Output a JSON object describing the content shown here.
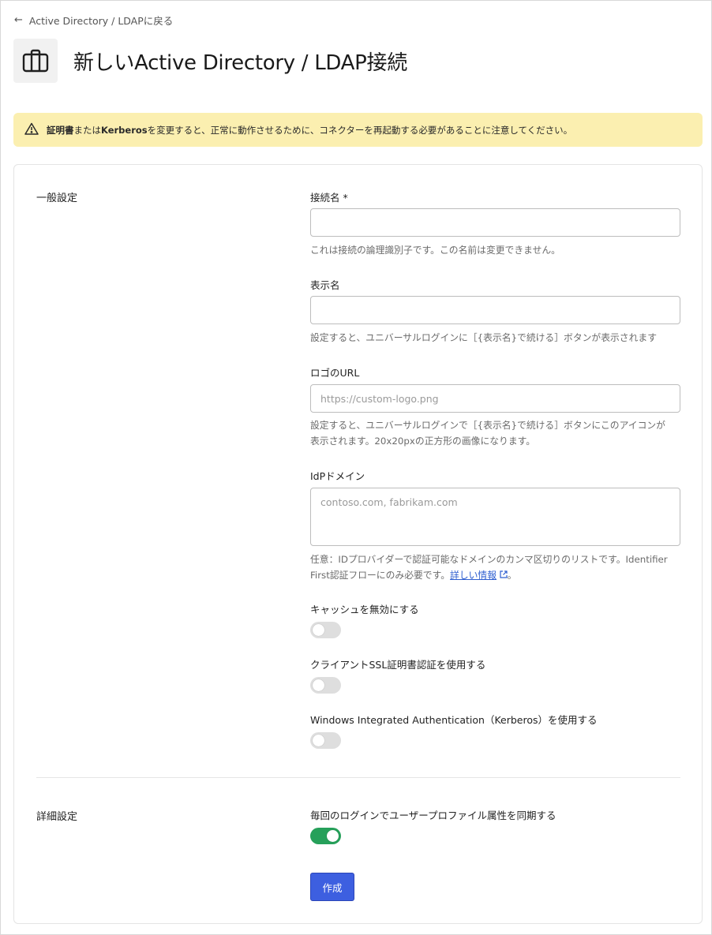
{
  "header": {
    "back_label": "Active Directory / LDAPに戻る",
    "title": "新しいActive Directory / LDAP接続"
  },
  "warning": {
    "bold1": "証明書",
    "text1": "または",
    "bold2": "Kerberos",
    "text2": "を変更すると、正常に動作させるために、コネクターを再起動する必要があることに注意してください。"
  },
  "general": {
    "section_label": "一般設定",
    "connection_name": {
      "label": "接続名 *",
      "value": "",
      "help": "これは接続の論理識別子です。この名前は変更できません。"
    },
    "display_name": {
      "label": "表示名",
      "value": "",
      "help": "設定すると、ユニバーサルログインに［{表示名}で続ける］ボタンが表示されます"
    },
    "logo_url": {
      "label": "ロゴのURL",
      "placeholder": "https://custom-logo.png",
      "help_line1": "設定すると、ユニバーサルログインで［{表示名}で続ける］ボタンにこのアイコンが",
      "help_line2": "表示されます。20x20pxの正方形の画像になります。"
    },
    "idp_domain": {
      "label": "IdPドメイン",
      "placeholder": "contoso.com, fabrikam.com",
      "help_line1": "任意：IDプロバイダーで認証可能なドメインのカンマ区切りのリストです。Identifier",
      "help_line2": "First認証フローにのみ必要です。",
      "help_link": "詳しい情報",
      "help_end": "。"
    },
    "disable_cache": {
      "label": "キャッシュを無効にする",
      "on": false
    },
    "client_ssl": {
      "label": "クライアントSSL証明書認証を使用する",
      "on": false
    },
    "kerberos": {
      "label": "Windows Integrated Authentication（Kerberos）を使用する",
      "on": false
    }
  },
  "advanced": {
    "section_label": "詳細設定",
    "sync_profile": {
      "label": "毎回のログインでユーザープロファイル属性を同期する",
      "on": true
    }
  },
  "actions": {
    "create_label": "作成"
  },
  "colors": {
    "warning_bg": "#fbefb0",
    "primary": "#3d5fe0",
    "toggle_on": "#26a05a",
    "link": "#2f5fd0"
  }
}
